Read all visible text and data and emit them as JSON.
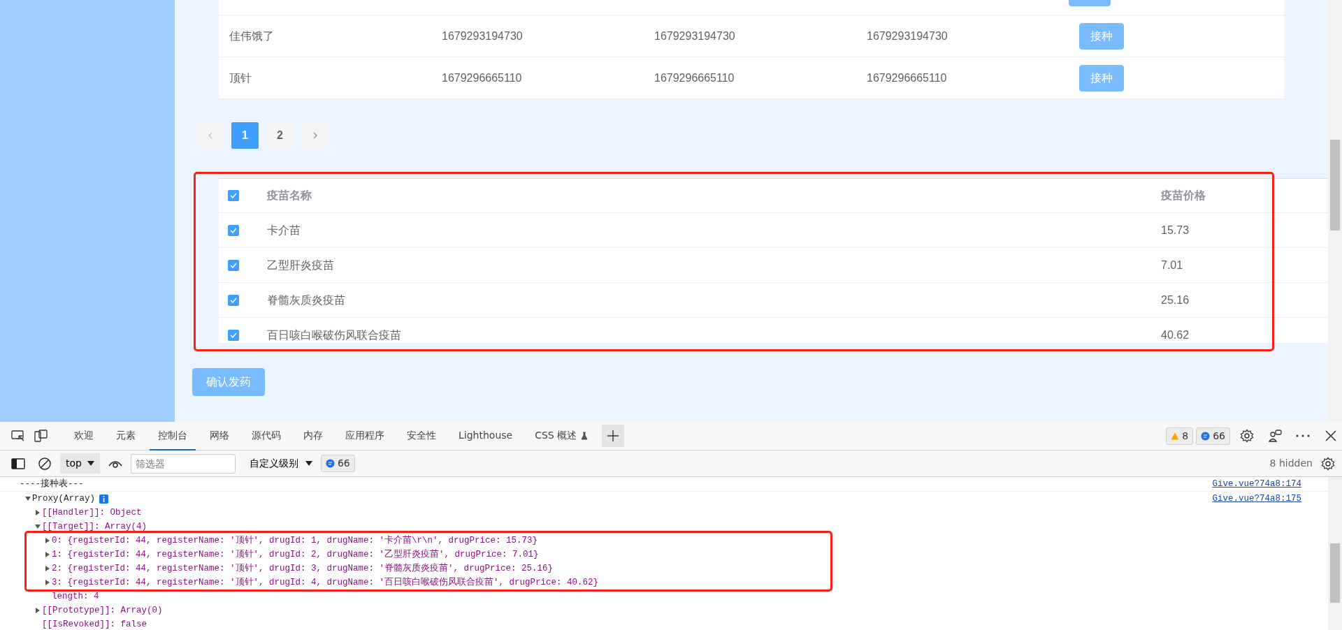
{
  "register_table": {
    "rows": [
      {
        "cells": [
          "佳伟饿了",
          "1679293194730",
          "1679293194730",
          "1679293194730"
        ],
        "action": "接种"
      },
      {
        "cells": [
          "顶针",
          "1679296665110",
          "1679296665110",
          "1679296665110"
        ],
        "action": "接种"
      }
    ]
  },
  "pagination": {
    "pages": [
      {
        "label": "1",
        "selected": true
      },
      {
        "label": "2",
        "selected": false
      }
    ]
  },
  "vaccine_table": {
    "columns": [
      "疫苗名称",
      "疫苗价格"
    ],
    "all_checked": true,
    "rows": [
      {
        "name": "卡介苗",
        "price": "15.73",
        "checked": true
      },
      {
        "name": "乙型肝炎疫苗",
        "price": "7.01",
        "checked": true
      },
      {
        "name": "脊髓灰质炎疫苗",
        "price": "25.16",
        "checked": true
      },
      {
        "name": "百日咳白喉破伤风联合疫苗",
        "price": "40.62",
        "checked": true
      }
    ]
  },
  "confirm_button": "确认发药",
  "devtools": {
    "tabs": [
      {
        "label": "欢迎",
        "selected": false
      },
      {
        "label": "元素",
        "selected": false
      },
      {
        "label": "控制台",
        "selected": true
      },
      {
        "label": "网络",
        "selected": false
      },
      {
        "label": "源代码",
        "selected": false
      },
      {
        "label": "内存",
        "selected": false
      },
      {
        "label": "应用程序",
        "selected": false
      },
      {
        "label": "安全性",
        "selected": false
      },
      {
        "label": "Lighthouse",
        "selected": false
      },
      {
        "label": "CSS 概述",
        "selected": false
      }
    ],
    "warnings": "8",
    "messages": "66",
    "context": "top",
    "filter_placeholder": "筛选器",
    "levels": "自定义级别",
    "level_messages": "66",
    "hidden": "8 hidden",
    "console": [
      {
        "kind": "log",
        "text": "----接种表---",
        "source": "Give.vue?74a8:174"
      },
      {
        "kind": "tree",
        "source": "Give.vue?74a8:175",
        "root": {
          "text": "Proxy(Array)",
          "expanded": true,
          "children": [
            {
              "text": "[[Handler]]: Object",
              "expanded": false
            },
            {
              "text": "[[Target]]: Array(4)",
              "expanded": true,
              "children": [
                {
                  "text": "0: {registerId: 44, registerName: '顶针', drugId: 1, drugName: '卡介苗\\r\\n', drugPrice: 15.73}",
                  "expanded": false
                },
                {
                  "text": "1: {registerId: 44, registerName: '顶针', drugId: 2, drugName: '乙型肝炎疫苗', drugPrice: 7.01}",
                  "expanded": false
                },
                {
                  "text": "2: {registerId: 44, registerName: '顶针', drugId: 3, drugName: '脊髓灰质炎疫苗', drugPrice: 25.16}",
                  "expanded": false
                },
                {
                  "text": "3: {registerId: 44, registerName: '顶针', drugId: 4, drugName: '百日咳白喉破伤风联合疫苗', drugPrice: 40.62}",
                  "expanded": false
                },
                {
                  "text": "length: 4"
                }
              ]
            },
            {
              "text": "[[Prototype]]: Array(0)",
              "expanded": false
            },
            {
              "text": "[[IsRevoked]]: false"
            }
          ]
        }
      }
    ]
  }
}
